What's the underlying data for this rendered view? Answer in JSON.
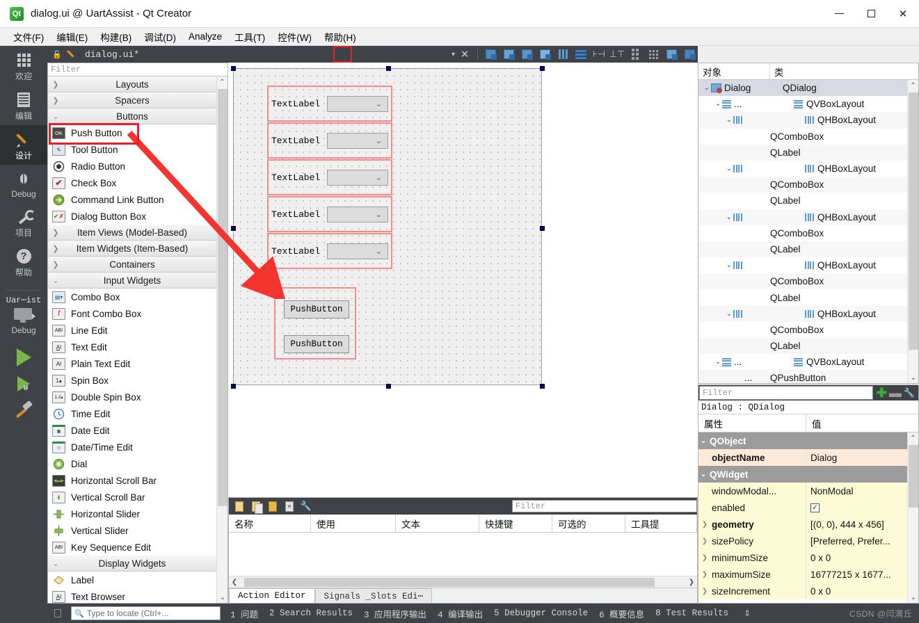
{
  "window": {
    "title": "dialog.ui @ UartAssist - Qt Creator",
    "app_icon": "qt-logo-icon",
    "minimize": "minimize-button",
    "maximize": "maximize-button",
    "close": "close-button"
  },
  "menubar": {
    "items": [
      {
        "text": "文件(F)",
        "mnemonic": "F"
      },
      {
        "text": "编辑(E)",
        "mnemonic": "E"
      },
      {
        "text": "构建(B)",
        "mnemonic": "B"
      },
      {
        "text": "调试(D)",
        "mnemonic": "D"
      },
      {
        "text": "Analyze",
        "mnemonic": "A"
      },
      {
        "text": "工具(T)",
        "mnemonic": "T"
      },
      {
        "text": "控件(W)",
        "mnemonic": "W"
      },
      {
        "text": "帮助(H)",
        "mnemonic": "H"
      }
    ]
  },
  "modebar": {
    "modes": [
      {
        "label": "欢迎",
        "icon": "grid-icon"
      },
      {
        "label": "编辑",
        "icon": "document-icon"
      },
      {
        "label": "设计",
        "icon": "pencil-icon",
        "active": true
      },
      {
        "label": "Debug",
        "icon": "bug-icon"
      },
      {
        "label": "项目",
        "icon": "wrench-icon"
      },
      {
        "label": "帮助",
        "icon": "question-icon"
      }
    ],
    "kit_name": "Uar⋯ist",
    "run_config": "Debug",
    "run_icon": "run-play-icon",
    "debug_icon": "debug-play-icon",
    "build_icon": "hammer-icon"
  },
  "formtoolbar": {
    "filename": "dialog.ui*",
    "lock_icon": "lock-open-icon",
    "edit_icon": "pencil-icon",
    "dropdown_icon": "chevron-down-icon",
    "close_icon": "close-x-icon",
    "buttons": [
      {
        "name": "edit-widgets-icon"
      },
      {
        "name": "edit-signals-slots-icon"
      },
      {
        "name": "edit-buddies-icon"
      },
      {
        "name": "edit-tab-order-icon"
      },
      {
        "name": "layout-horizontally-icon"
      },
      {
        "name": "layout-vertically-icon",
        "highlighted": true
      },
      {
        "name": "layout-splitter-horizontal-icon"
      },
      {
        "name": "layout-splitter-vertical-icon"
      },
      {
        "name": "layout-form-icon"
      },
      {
        "name": "layout-grid-icon"
      },
      {
        "name": "break-layout-icon"
      },
      {
        "name": "adjust-size-icon"
      }
    ]
  },
  "widgetbox": {
    "filter_placeholder": "Filter",
    "groups": [
      {
        "label": "Layouts",
        "expanded": false,
        "items": []
      },
      {
        "label": "Spacers",
        "expanded": false,
        "items": []
      },
      {
        "label": "Buttons",
        "expanded": true,
        "items": [
          {
            "label": "Push Button",
            "icon": "ok",
            "highlighted": true
          },
          {
            "label": "Tool Button",
            "icon": "tool"
          },
          {
            "label": "Radio Button",
            "icon": "radio"
          },
          {
            "label": "Check Box",
            "icon": "check"
          },
          {
            "label": "Command Link Button",
            "icon": "cmdlink"
          },
          {
            "label": "Dialog Button Box",
            "icon": "dlgbtn"
          }
        ]
      },
      {
        "label": "Item Views (Model-Based)",
        "expanded": false,
        "items": []
      },
      {
        "label": "Item Widgets (Item-Based)",
        "expanded": false,
        "items": []
      },
      {
        "label": "Containers",
        "expanded": false,
        "items": []
      },
      {
        "label": "Input Widgets",
        "expanded": true,
        "items": [
          {
            "label": "Combo Box",
            "icon": "combo"
          },
          {
            "label": "Font Combo Box",
            "icon": "fontcombo"
          },
          {
            "label": "Line Edit",
            "icon": "abi"
          },
          {
            "label": "Text Edit",
            "icon": "ai_u"
          },
          {
            "label": "Plain Text Edit",
            "icon": "ai"
          },
          {
            "label": "Spin Box",
            "icon": "spin1"
          },
          {
            "label": "Double Spin Box",
            "icon": "spin12"
          },
          {
            "label": "Time Edit",
            "icon": "clock"
          },
          {
            "label": "Date Edit",
            "icon": "calendar"
          },
          {
            "label": "Date/Time Edit",
            "icon": "calendarclock"
          },
          {
            "label": "Dial",
            "icon": "dial"
          },
          {
            "label": "Horizontal Scroll Bar",
            "icon": "hscroll"
          },
          {
            "label": "Vertical Scroll Bar",
            "icon": "vscroll"
          },
          {
            "label": "Horizontal Slider",
            "icon": "hslider"
          },
          {
            "label": "Vertical Slider",
            "icon": "vslider"
          },
          {
            "label": "Key Sequence Edit",
            "icon": "abi"
          }
        ]
      },
      {
        "label": "Display Widgets",
        "expanded": true,
        "items": [
          {
            "label": "Label",
            "icon": "label"
          },
          {
            "label": "Text Browser",
            "icon": "ai_u"
          }
        ]
      }
    ]
  },
  "canvas": {
    "form_object": "Dialog",
    "form_size": "444 x 456",
    "label_text": "TextLabel",
    "rows": [
      {
        "label": "TextLabel",
        "widget": "combobox"
      },
      {
        "label": "TextLabel",
        "widget": "combobox"
      },
      {
        "label": "TextLabel",
        "widget": "combobox"
      },
      {
        "label": "TextLabel",
        "widget": "combobox"
      },
      {
        "label": "TextLabel",
        "widget": "combobox"
      }
    ],
    "buttons": [
      {
        "label": "PushButton"
      },
      {
        "label": "PushButton"
      }
    ]
  },
  "object_inspector": {
    "headers": {
      "object": "对象",
      "class": "类"
    },
    "rows": [
      {
        "indent": 0,
        "expander": "v",
        "name": "Dialog",
        "icon": "dialog-icon",
        "class": "QDialog",
        "class_icon": "",
        "selected": true
      },
      {
        "indent": 1,
        "expander": "v",
        "name": "...",
        "icon": "vbox-icon",
        "class": "QVBoxLayout",
        "class_icon": "vbox-icon"
      },
      {
        "indent": 2,
        "expander": "v",
        "name": "",
        "icon": "hbox-icon",
        "class": "QHBoxLayout",
        "class_icon": "hbox-icon"
      },
      {
        "indent": 3,
        "expander": "",
        "name": "",
        "icon": "",
        "class": "QComboBox",
        "class_icon": ""
      },
      {
        "indent": 3,
        "expander": "",
        "name": "",
        "icon": "",
        "class": "QLabel",
        "class_icon": ""
      },
      {
        "indent": 2,
        "expander": "v",
        "name": "",
        "icon": "hbox-icon",
        "class": "QHBoxLayout",
        "class_icon": "hbox-icon"
      },
      {
        "indent": 3,
        "expander": "",
        "name": "",
        "icon": "",
        "class": "QComboBox",
        "class_icon": ""
      },
      {
        "indent": 3,
        "expander": "",
        "name": "",
        "icon": "",
        "class": "QLabel",
        "class_icon": ""
      },
      {
        "indent": 2,
        "expander": "v",
        "name": "",
        "icon": "hbox-icon",
        "class": "QHBoxLayout",
        "class_icon": "hbox-icon"
      },
      {
        "indent": 3,
        "expander": "",
        "name": "",
        "icon": "",
        "class": "QComboBox",
        "class_icon": ""
      },
      {
        "indent": 3,
        "expander": "",
        "name": "",
        "icon": "",
        "class": "QLabel",
        "class_icon": ""
      },
      {
        "indent": 2,
        "expander": "v",
        "name": "",
        "icon": "hbox-icon",
        "class": "QHBoxLayout",
        "class_icon": "hbox-icon"
      },
      {
        "indent": 3,
        "expander": "",
        "name": "",
        "icon": "",
        "class": "QComboBox",
        "class_icon": ""
      },
      {
        "indent": 3,
        "expander": "",
        "name": "",
        "icon": "",
        "class": "QLabel",
        "class_icon": ""
      },
      {
        "indent": 2,
        "expander": "v",
        "name": "",
        "icon": "hbox-icon",
        "class": "QHBoxLayout",
        "class_icon": "hbox-icon"
      },
      {
        "indent": 3,
        "expander": "",
        "name": "",
        "icon": "",
        "class": "QComboBox",
        "class_icon": ""
      },
      {
        "indent": 3,
        "expander": "",
        "name": "",
        "icon": "",
        "class": "QLabel",
        "class_icon": ""
      },
      {
        "indent": 1,
        "expander": "v",
        "name": "...",
        "icon": "vbox-icon",
        "class": "QVBoxLayout",
        "class_icon": "vbox-icon"
      },
      {
        "indent": 2,
        "expander": "",
        "name": "...",
        "icon": "",
        "class": "QPushButton",
        "class_icon": ""
      }
    ]
  },
  "property_editor": {
    "filter_placeholder": "Filter",
    "add_icon": "plus-icon",
    "remove_icon": "minus-icon",
    "config_icon": "wrench-icon",
    "subject": "Dialog : QDialog",
    "headers": {
      "property": "属性",
      "value": "值"
    },
    "rows": [
      {
        "type": "group",
        "name": "QObject",
        "value": "",
        "expander": "v"
      },
      {
        "type": "prop",
        "name": "objectName",
        "value": "Dialog",
        "bold": true,
        "highlight": "orange",
        "expander": ""
      },
      {
        "type": "group",
        "name": "QWidget",
        "value": "",
        "expander": "v"
      },
      {
        "type": "prop",
        "name": "windowModal...",
        "value": "NonModal",
        "highlight": "yellow",
        "expander": ""
      },
      {
        "type": "prop",
        "name": "enabled",
        "value": "",
        "checkbox": true,
        "checked": true,
        "highlight": "yellow",
        "expander": ""
      },
      {
        "type": "prop",
        "name": "geometry",
        "value": "[(0, 0), 444 x 456]",
        "bold": true,
        "highlight": "yellow",
        "expander": ">"
      },
      {
        "type": "prop",
        "name": "sizePolicy",
        "value": "[Preferred, Prefer...",
        "highlight": "yellow",
        "expander": ">"
      },
      {
        "type": "prop",
        "name": "minimumSize",
        "value": "0 x 0",
        "highlight": "yellow",
        "expander": ">"
      },
      {
        "type": "prop",
        "name": "maximumSize",
        "value": "16777215 x 1677...",
        "highlight": "yellow",
        "expander": ">"
      },
      {
        "type": "prop",
        "name": "sizeIncrement",
        "value": "0 x 0",
        "highlight": "yellow",
        "expander": ">"
      }
    ]
  },
  "action_editor": {
    "filter_placeholder": "Filter",
    "toolbar_icons": [
      "new-action-icon",
      "copy-icon",
      "paste-icon",
      "delete-icon",
      "configure-icon"
    ],
    "columns": [
      "名称",
      "使用",
      "文本",
      "快捷键",
      "可选的",
      "工具提"
    ],
    "tabs": [
      {
        "label": "Action Editor",
        "active": true
      },
      {
        "label": "Signals _Slots Edi⋯",
        "active": false
      }
    ]
  },
  "statusbar": {
    "locate_placeholder": "Type to locate (Ctrl+...",
    "search_icon": "search-icon",
    "items": [
      "1 问题",
      "2 Search Results",
      "3 应用程序输出",
      "4 编译输出",
      "5 Debugger Console",
      "6 概要信息",
      "8 Test Results"
    ],
    "updown_icon": "up-down-arrows-icon",
    "watermark": "CSDN @闫渭丘"
  },
  "colors": {
    "accent_red": "#ee1c25",
    "dark_chrome": "#3f4246",
    "arrow_red": "#f4342e",
    "selection_blue": "#00007f",
    "layout_outline": "#f98a8a"
  }
}
